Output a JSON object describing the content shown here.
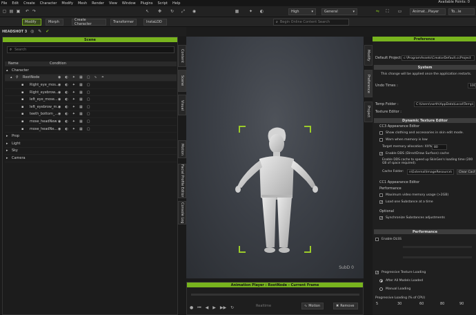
{
  "menu": {
    "items": [
      "File",
      "Edit",
      "Create",
      "Character",
      "Modify",
      "Mesh",
      "Render",
      "View",
      "Window",
      "Plugins",
      "Script",
      "Help"
    ],
    "available_points": "Available Points: 0",
    "tabs": [
      "Animat...Player",
      "To...le"
    ]
  },
  "toolbar": {
    "modify": "Modify",
    "morph": "Morph",
    "create_character": "Create Character",
    "transformer": "Transformer",
    "install_dd": "InstaLOD",
    "quality": "High",
    "mode": "General",
    "content_search_placeholder": "Begin Online Content Search"
  },
  "headshot": "HEADSHOT 3",
  "scene": {
    "title": "Scene",
    "search_placeholder": "Search",
    "col_name": "Name",
    "col_condition": "Condition",
    "rows": [
      {
        "label": "Character"
      },
      {
        "label": "RootNode"
      },
      {
        "label": "Right_eye_mos..."
      },
      {
        "label": "Right_eyebrow..."
      },
      {
        "label": "left_eye_mose..."
      },
      {
        "label": "left_eyebrow_m..."
      },
      {
        "label": "teeth_bottom_..."
      },
      {
        "label": "mose_headNew"
      },
      {
        "label": "mose_headNe..."
      },
      {
        "label": "Prop"
      },
      {
        "label": "Light"
      },
      {
        "label": "Sky"
      },
      {
        "label": "Camera"
      }
    ]
  },
  "left_tabs": [
    "Content",
    "Scene",
    "Visual",
    "Motion",
    "Facial Profile Editor",
    "Console Log"
  ],
  "right_tabs": [
    "Modify",
    "Preference",
    "Project"
  ],
  "viewport": {
    "label": "SubD 0"
  },
  "anim": {
    "title": "Animation Player : RootNode - Current Frame",
    "motion": "Motion",
    "remove": "Remove",
    "realtime": "Realtime"
  },
  "pref": {
    "title": "Preference",
    "default_project_label": "Default Project:",
    "default_project_value": "c:\\ProgramAssets\\CreatorDefault.ccProject",
    "system": "System",
    "restart_note": "This change will be applied once the application restarts.",
    "undo_label": "Undo Times :",
    "undo_value": "100",
    "temp_label": "Temp Folder :",
    "temp_value": "C:\\Users\\north\\AppData\\Local\\Temp\\",
    "texture_label": "Texture Editor :",
    "dynamic": "Dynamic Texture Editor",
    "cc3": "CC3 Appearance Editor",
    "opt_show_clothing": "Show clothing and accessories in skin edit mode.",
    "opt_warn_memory": "Warn when memory is low",
    "target_memory_label": "Target memory allocation: XX%",
    "target_memory_value": "80",
    "opt_enable_dds": "Enable DDS (DirectDraw Surface) cache",
    "dds_note": "Enable DDS cache to speed up SkinGen's loading time (200 GB of space required).",
    "cache_label": "Cache Folder:",
    "cache_value": "n\\External\\ImageResource\\",
    "clear_cache": "Clear Cache",
    "cc1": "CC1 Appearance Editor",
    "performance_sub": "Performance",
    "opt_max_video": "Maximum video memory usage (>2GB)",
    "opt_load_one": "Load one Substance at a time",
    "optional": "Optional",
    "opt_sync": "Synchronize Substances adjustments",
    "performance": "Performance",
    "enable_dlss": "Enable DLSS",
    "opt_progressive": "Progressive Texture Loading",
    "radio_after": "After All Models Loaded",
    "radio_manual": "Manual Loading",
    "progressive_label": "Progressive Loading (% of CPU)",
    "ticks": [
      "5",
      "30",
      "60",
      "80",
      "90"
    ]
  }
}
